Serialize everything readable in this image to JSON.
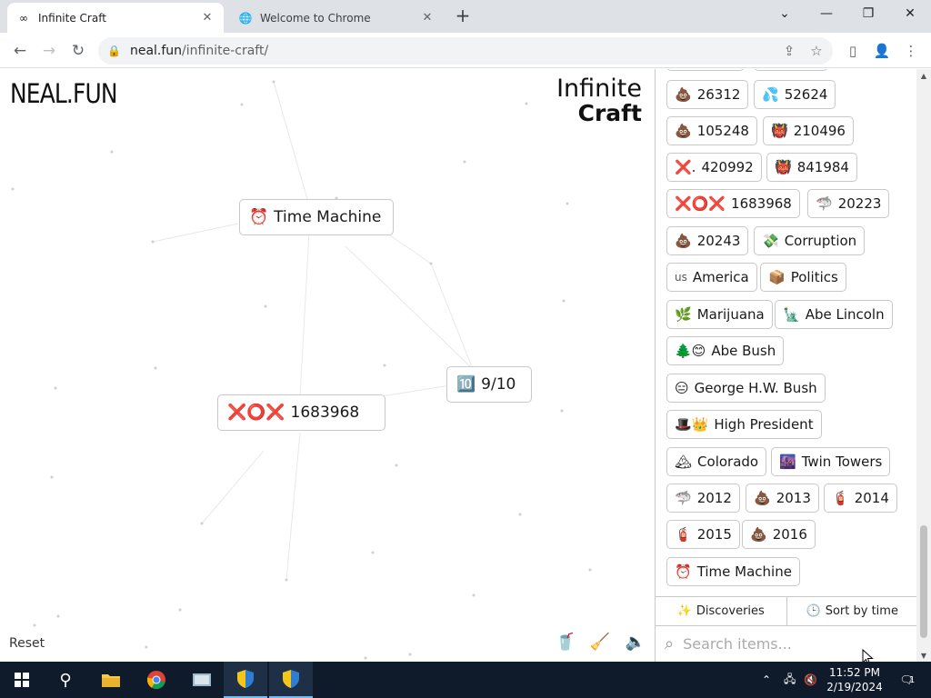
{
  "browser": {
    "tabs": [
      {
        "title": "Infinite Craft",
        "icon": "infinity-icon",
        "active": true
      },
      {
        "title": "Welcome to Chrome",
        "icon": "globe-icon",
        "active": false
      }
    ],
    "url_host": "neal.fun",
    "url_path": "/infinite-craft/"
  },
  "page": {
    "logo_left": "NEAL.FUN",
    "logo_right_line1": "Infinite",
    "logo_right_line2": "Craft",
    "reset_label": "Reset"
  },
  "canvas_elements": [
    {
      "emoji": "⏰",
      "label": "Time Machine"
    },
    {
      "emoji": "🔟",
      "label": "9/10"
    },
    {
      "emoji": "❌⭕❌",
      "label": "1683968"
    }
  ],
  "sidebar": {
    "items": [
      {
        "emoji": "💩",
        "label": "26312"
      },
      {
        "emoji": "💦",
        "label": "52624"
      },
      {
        "emoji": "💩",
        "label": "105248"
      },
      {
        "emoji": "👹",
        "label": "210496"
      },
      {
        "emoji": "❌.",
        "label": "420992"
      },
      {
        "emoji": "👹",
        "label": "841984"
      },
      {
        "emoji": "❌⭕❌",
        "label": "1683968"
      },
      {
        "emoji": "🦈",
        "label": "20223"
      },
      {
        "emoji": "💩",
        "label": "20243"
      },
      {
        "emoji": "💸",
        "label": "Corruption"
      },
      {
        "emoji": "us",
        "label": "America"
      },
      {
        "emoji": "📦",
        "label": "Politics"
      },
      {
        "emoji": "🌿",
        "label": "Marijuana"
      },
      {
        "emoji": "🗽",
        "label": "Abe Lincoln"
      },
      {
        "emoji": "🌲😊",
        "label": "Abe Bush"
      },
      {
        "emoji": "😑",
        "label": "George H.W. Bush"
      },
      {
        "emoji": "🎩👑",
        "label": "High President"
      },
      {
        "emoji": "🏔",
        "label": "Colorado"
      },
      {
        "emoji": "🌆",
        "label": "Twin Towers"
      },
      {
        "emoji": "🦈",
        "label": "2012"
      },
      {
        "emoji": "💩",
        "label": "2013"
      },
      {
        "emoji": "🧯",
        "label": "2014"
      },
      {
        "emoji": "🧯",
        "label": "2015"
      },
      {
        "emoji": "💩",
        "label": "2016"
      },
      {
        "emoji": "⏰",
        "label": "Time Machine"
      }
    ],
    "discoveries_label": "Discoveries",
    "sort_label": "Sort by time",
    "search_placeholder": "Search items..."
  },
  "taskbar": {
    "time": "11:52 PM",
    "date": "2/19/2024",
    "notification_count": "1"
  }
}
